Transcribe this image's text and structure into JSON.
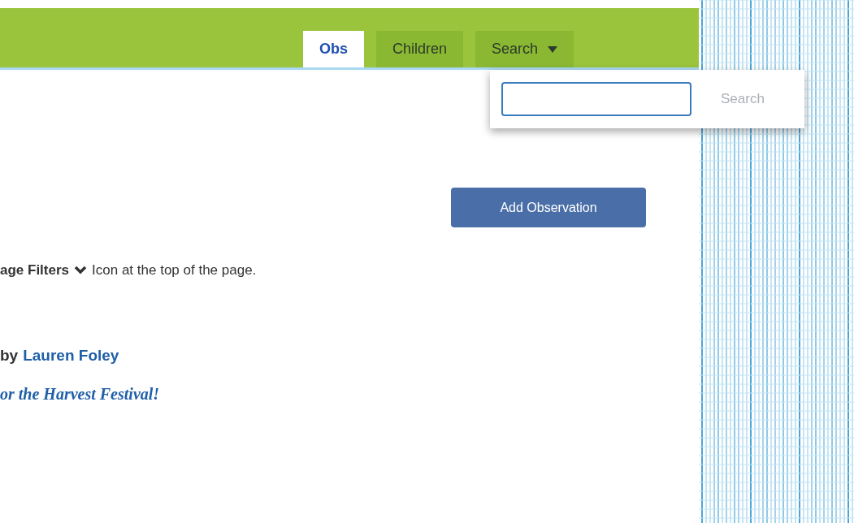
{
  "tabs": [
    {
      "label": "Obs",
      "selected": true,
      "kind": "tab"
    },
    {
      "label": "Children",
      "selected": false,
      "kind": "tab"
    },
    {
      "label": "Search",
      "selected": false,
      "kind": "dropdown"
    }
  ],
  "search_dropdown": {
    "button": "Search"
  },
  "add_button": "Add Observation",
  "hint": {
    "bold_part": "age Filters",
    "rest": "Icon at the top of the page."
  },
  "post": {
    "by": "by",
    "author": "Lauren Foley",
    "caption": "or the Harvest Festival!"
  }
}
